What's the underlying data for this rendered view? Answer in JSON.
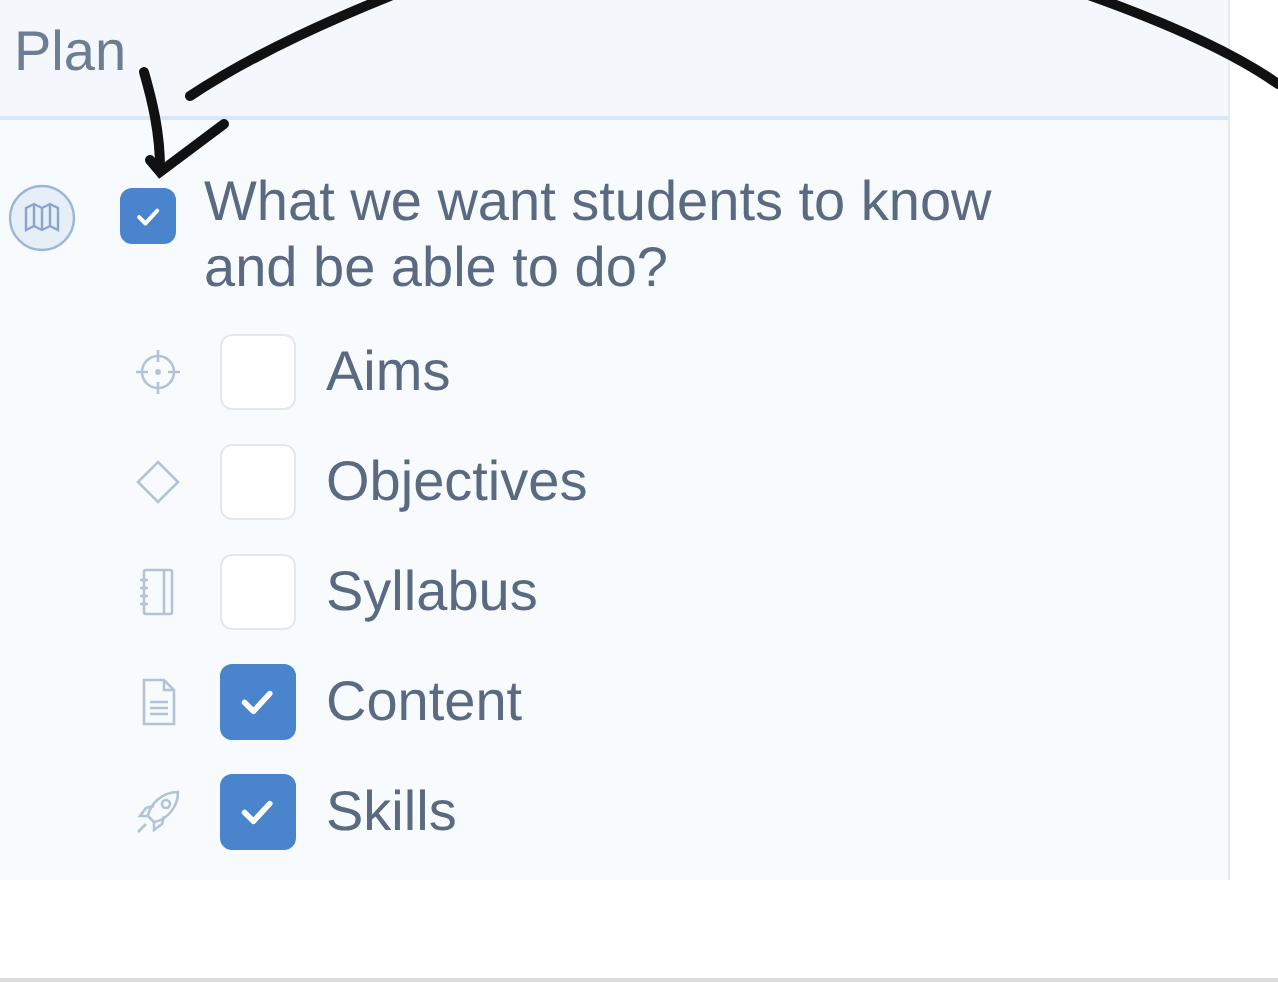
{
  "panel": {
    "title": "Plan"
  },
  "root": {
    "label": "What we want students to know and be able to do?",
    "checked": true,
    "children": [
      {
        "label": "Aims",
        "checked": false
      },
      {
        "label": "Objectives",
        "checked": false
      },
      {
        "label": "Syllabus",
        "checked": false
      },
      {
        "label": "Content",
        "checked": true
      },
      {
        "label": "Skills",
        "checked": true
      }
    ]
  }
}
